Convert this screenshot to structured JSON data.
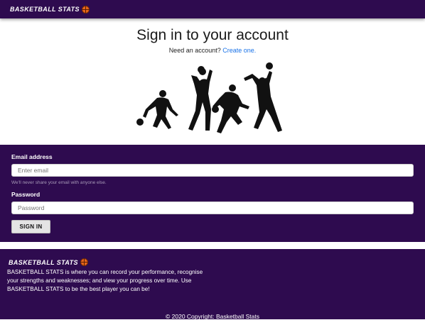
{
  "navbar": {
    "brand": "BASKETBALL STATS",
    "brand_icon": "basketball-icon"
  },
  "main": {
    "title": "Sign in to your account",
    "need_account": "Need an account?",
    "create_link": "Create one."
  },
  "form": {
    "email_label": "Email address",
    "email_placeholder": "Enter email",
    "email_help": "We'll never share your email with anyone else.",
    "password_label": "Password",
    "password_placeholder": "Password",
    "submit_label": "SIGN IN"
  },
  "footer": {
    "brand": "BASKETBALL STATS",
    "description": "BASKETBALL STATS is where you can record your performance, recognise your strengths and weaknesses; and view your progress over time. Use BASKETBALL STATS to be the best player you can be!",
    "copyright": "© 2020 Copyright: Basketball Stats"
  },
  "colors": {
    "panel": "#2e0b4f",
    "link": "#1a73e8",
    "ball": "#e8661c"
  }
}
